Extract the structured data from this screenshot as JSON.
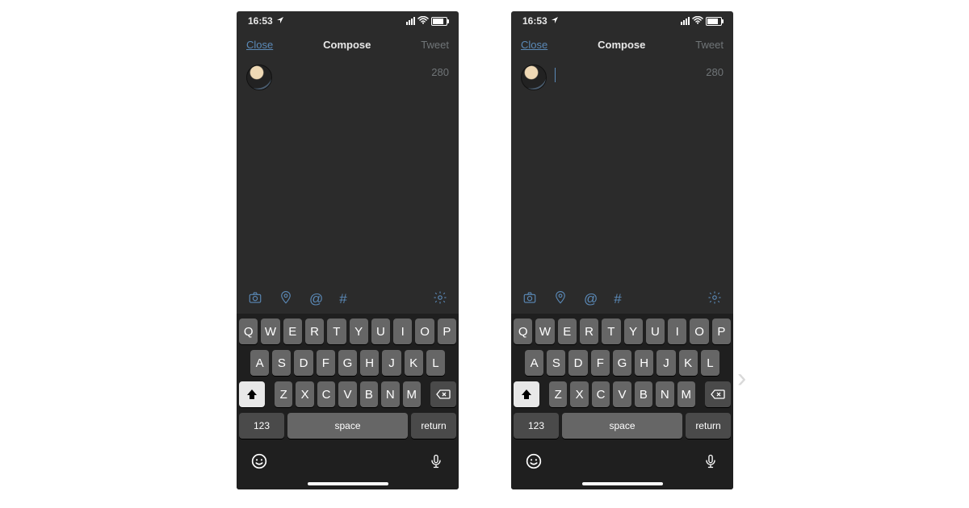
{
  "status": {
    "time": "16:53"
  },
  "nav": {
    "close": "Close",
    "title": "Compose",
    "tweet": "Tweet"
  },
  "compose": {
    "char_count": "280"
  },
  "toolbar": {
    "at": "@",
    "hash": "#"
  },
  "keyboard": {
    "row1": [
      "Q",
      "W",
      "E",
      "R",
      "T",
      "Y",
      "U",
      "I",
      "O",
      "P"
    ],
    "row2": [
      "A",
      "S",
      "D",
      "F",
      "G",
      "H",
      "J",
      "K",
      "L"
    ],
    "row3": [
      "Z",
      "X",
      "C",
      "V",
      "B",
      "N",
      "M"
    ],
    "num": "123",
    "space": "space",
    "return": "return"
  },
  "screens": [
    {
      "show_cursor": false
    },
    {
      "show_cursor": true
    }
  ]
}
